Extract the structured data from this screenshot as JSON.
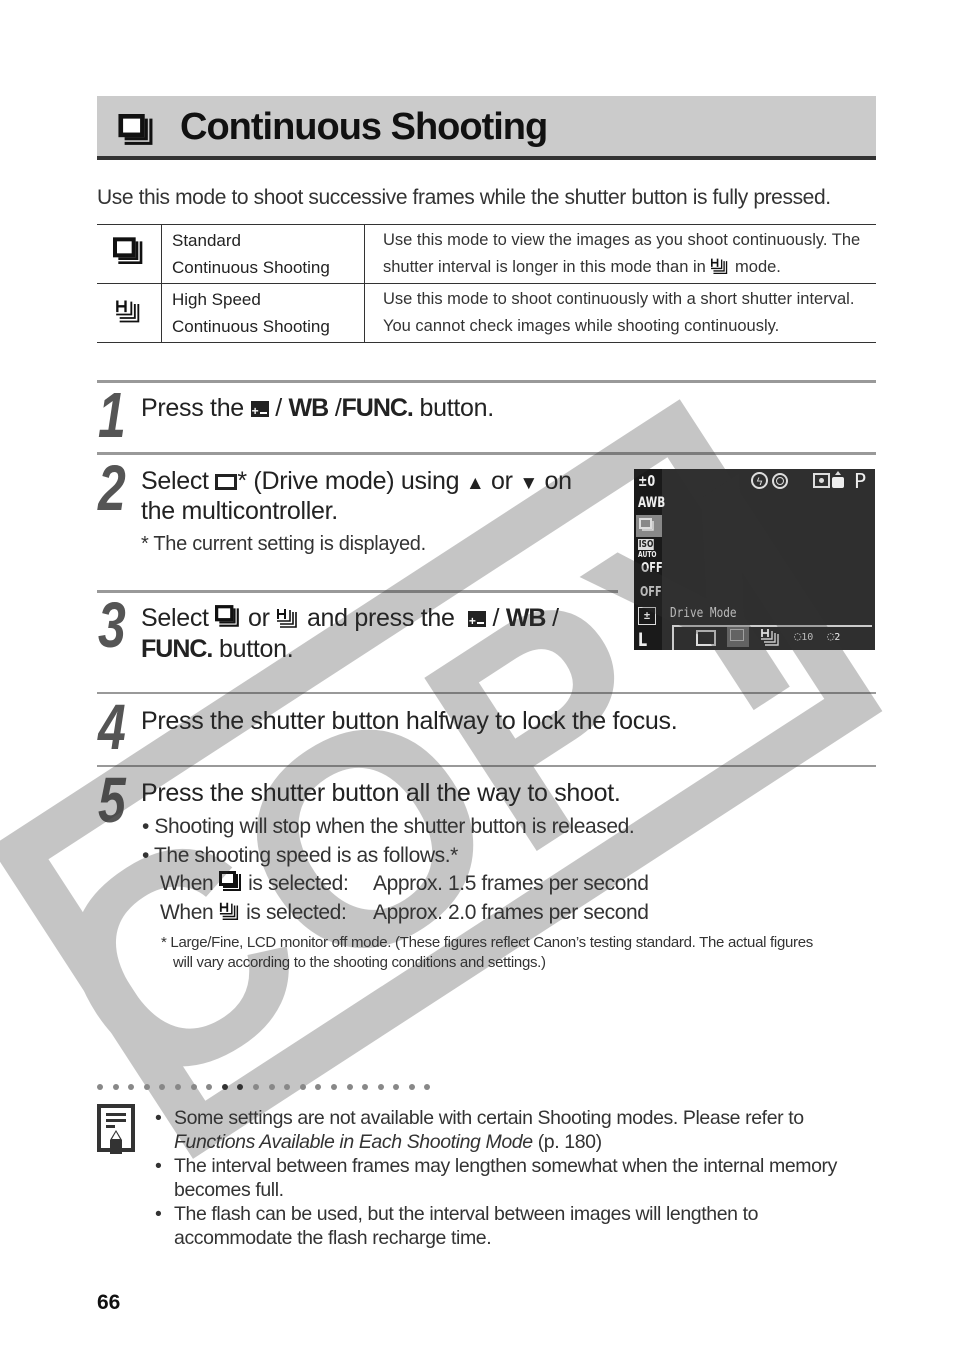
{
  "title": "Continuous Shooting",
  "intro": "Use this mode to shoot successive frames while the shutter button is fully pressed.",
  "modes": [
    {
      "icon": "standard-continuous-icon",
      "name_line1": "Standard",
      "name_line2": "Continuous Shooting",
      "desc_line1": "Use this mode to view the images as you shoot continuously. The",
      "desc_line2_pre": "shutter interval is longer in this mode than in",
      "desc_line2_post": "mode."
    },
    {
      "icon": "high-speed-continuous-icon",
      "name_line1": "High Speed",
      "name_line2": "Continuous Shooting",
      "desc_line1": "Use this mode to shoot continuously with a short shutter interval.",
      "desc_line2": "You cannot check images while shooting continuously."
    }
  ],
  "steps": {
    "s1": {
      "num": "1",
      "pre": "Press the",
      "wb": "WB",
      "func": "FUNC.",
      "post": "button.",
      "sep": "/"
    },
    "s2": {
      "num": "2",
      "pre": "Select",
      "mid": "* (Drive mode) using",
      "up": "▲",
      "or": "or",
      "down": "▼",
      "post": "on",
      "line2": "the multicontroller.",
      "note": "* The current setting is displayed."
    },
    "s3": {
      "num": "3",
      "pre": "Select",
      "or": "or",
      "mid": "and press the",
      "wb": "WB",
      "sep": "/",
      "func": "FUNC.",
      "post": "button."
    },
    "s4": {
      "num": "4",
      "text": "Press the shutter button halfway to lock the focus."
    },
    "s5": {
      "num": "5",
      "text": "Press the shutter button all the way to shoot.",
      "bullet1": "• Shooting will stop when the shutter button is released.",
      "bullet2": "• The shooting speed is as follows.*",
      "when": "When",
      "selected": "is selected:",
      "rate_standard": "Approx. 1.5 frames per second",
      "rate_high": "Approx. 2.0 frames per second",
      "footnote_line1": "* Large/Fine, LCD monitor off mode. (These figures reflect Canon’s testing standard. The actual figures",
      "footnote_line2": "will vary according to the shooting conditions and settings.)"
    }
  },
  "lcd": {
    "exposure": "±0",
    "wb": "AWB",
    "iso_top": "ISO",
    "iso_bottom": "AUTO",
    "off1": "OFF",
    "off2": "OFF",
    "quality": "L",
    "mode": "P",
    "menu_label": "Drive Mode",
    "options": [
      "single",
      "continuous",
      "high-speed-continuous",
      "self-timer-10s",
      "self-timer-2s"
    ],
    "selected_option": "continuous",
    "timer10": "10",
    "timer2": "2"
  },
  "notes": {
    "n1_line1": "Some settings are not available with certain Shooting modes.  Please refer to",
    "n1_italic": "Functions Available in Each Shooting Mode",
    "n1_ref": " (p. 180)",
    "n2": "The interval between frames may lengthen somewhat when the internal memory becomes full.",
    "n3": "The flash can be used, but the interval between images will lengthen to accommodate the flash recharge time."
  },
  "page_number": "66",
  "watermark": "COPY"
}
